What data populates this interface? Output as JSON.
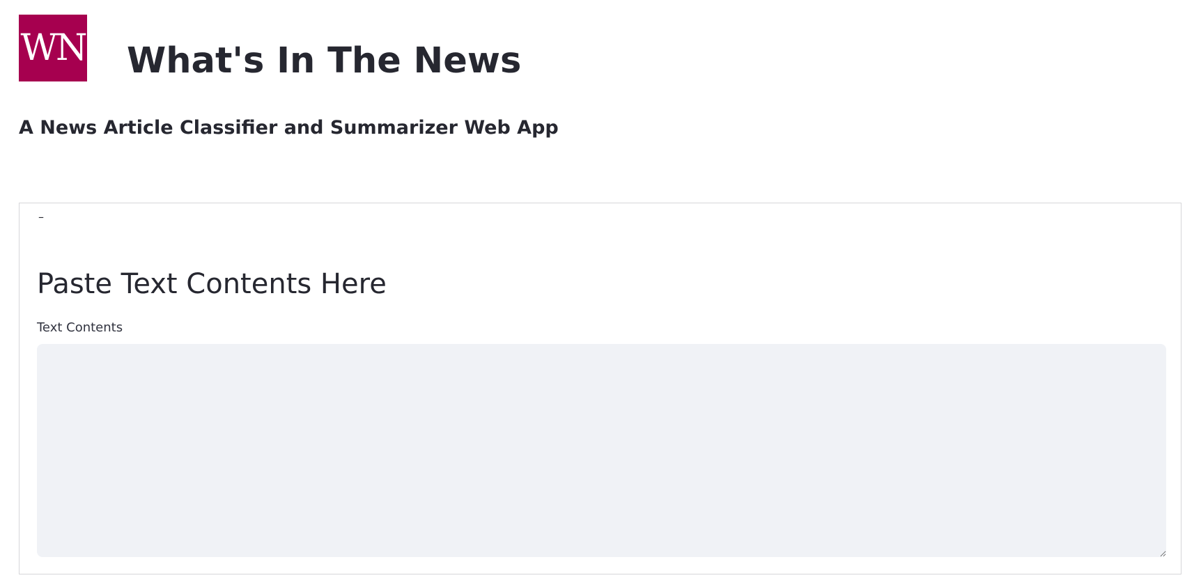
{
  "header": {
    "logo_text": "WN",
    "logo_color": "#a6004f",
    "title": "What's In The News"
  },
  "subtitle": "A News Article Classifier and Summarizer Web App",
  "form": {
    "collapse_symbol": "–",
    "heading": "Paste Text Contents Here",
    "text_contents": {
      "label": "Text Contents",
      "value": "",
      "placeholder": ""
    }
  },
  "colors": {
    "text": "#262730",
    "input_background": "#f0f2f6",
    "border": "#d6d6d9"
  }
}
